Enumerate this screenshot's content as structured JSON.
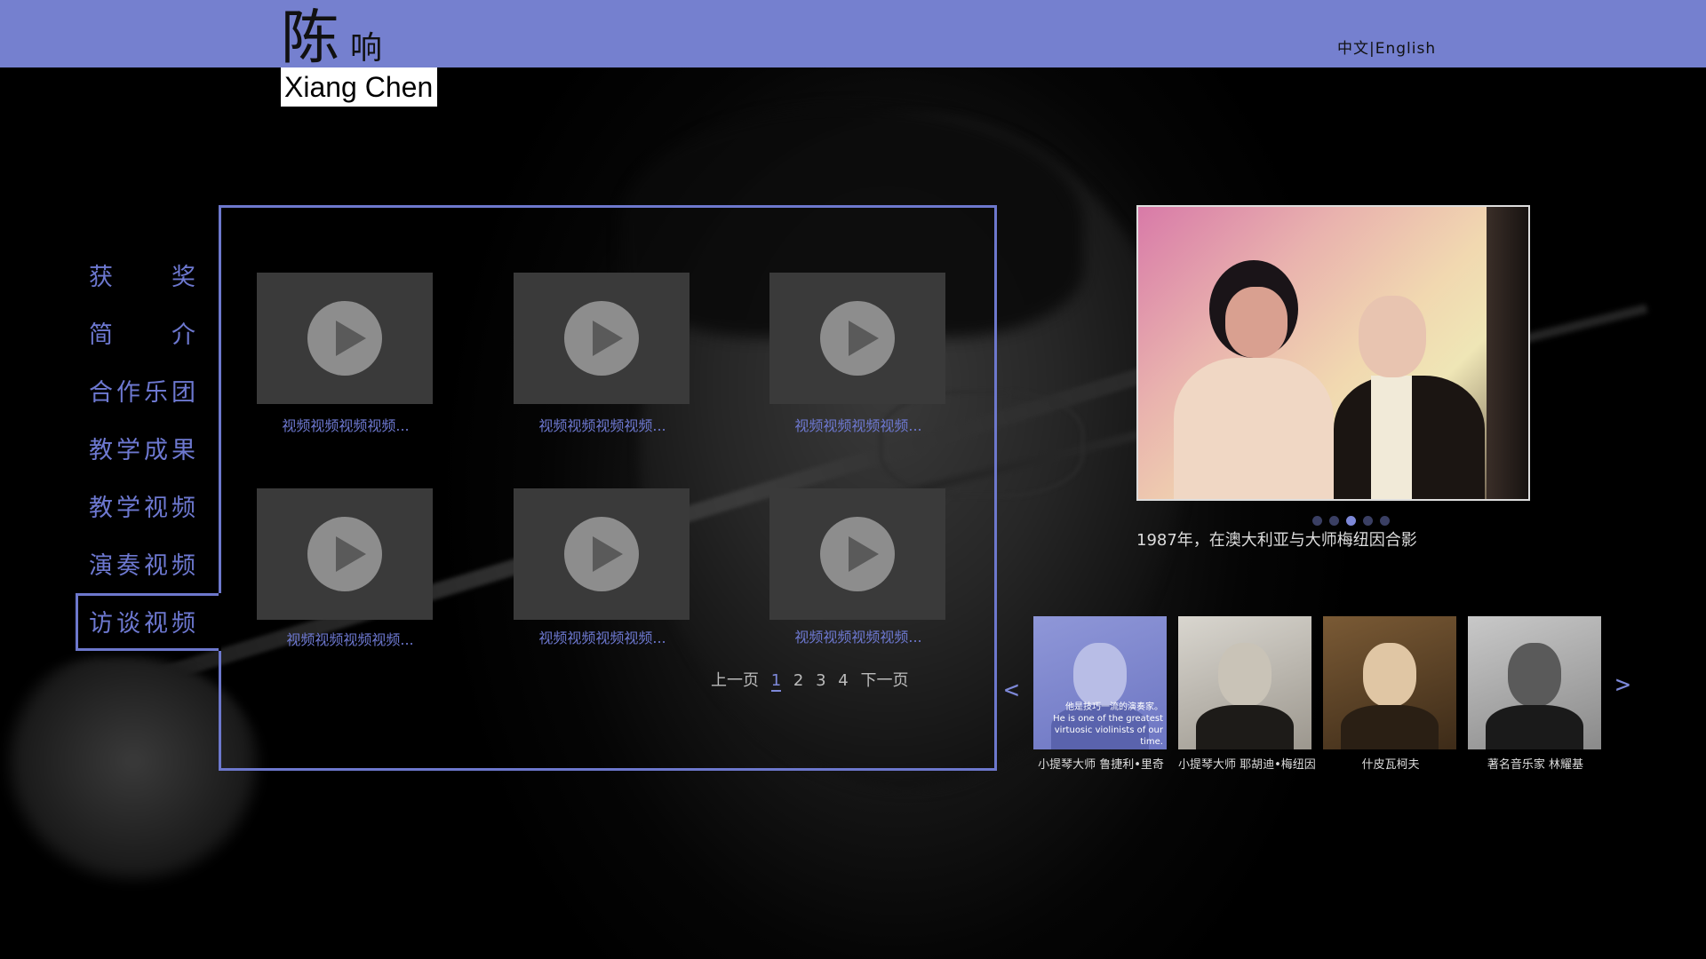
{
  "header": {
    "name_cn_main": "陈",
    "name_cn_sub": "响",
    "name_en": "Xiang Chen",
    "lang_cn": "中文",
    "lang_sep": "|",
    "lang_en": "English"
  },
  "nav": {
    "items": [
      {
        "label": "获 奖"
      },
      {
        "label": "简 介"
      },
      {
        "label": "合作乐团"
      },
      {
        "label": "教学成果"
      },
      {
        "label": "教学视频"
      },
      {
        "label": "演奏视频"
      },
      {
        "label": "访谈视频"
      }
    ],
    "active_index": 6
  },
  "videos": {
    "items": [
      {
        "caption": "视频视频视频视频..."
      },
      {
        "caption": "视频视频视频视频..."
      },
      {
        "caption": "视频视频视频视频..."
      },
      {
        "caption": "视频视频视频视频..."
      },
      {
        "caption": "视频视频视频视频..."
      },
      {
        "caption": "视频视频视频视频..."
      }
    ],
    "pager": {
      "prev": "上一页",
      "pages": [
        "1",
        "2",
        "3",
        "4"
      ],
      "current": "1",
      "next": "下一页"
    }
  },
  "slider": {
    "caption": "1987年，在澳大利亚与大师梅纽因合影",
    "dot_count": 5,
    "active_dot": 2
  },
  "people": {
    "prev_arrow": "<",
    "next_arrow": ">",
    "items": [
      {
        "name": "小提琴大师 鲁捷利•里奇",
        "overlay_cn": "他是技巧一流的演奏家。",
        "overlay_en": "He is one of the greatest virtuosic violinists of our time."
      },
      {
        "name": "小提琴大师 耶胡迪•梅纽因"
      },
      {
        "name": "什皮瓦柯夫"
      },
      {
        "name": "著名音乐家 林耀基"
      }
    ]
  },
  "colors": {
    "accent": "#7580cf",
    "nav_text": "#6d78d0"
  }
}
